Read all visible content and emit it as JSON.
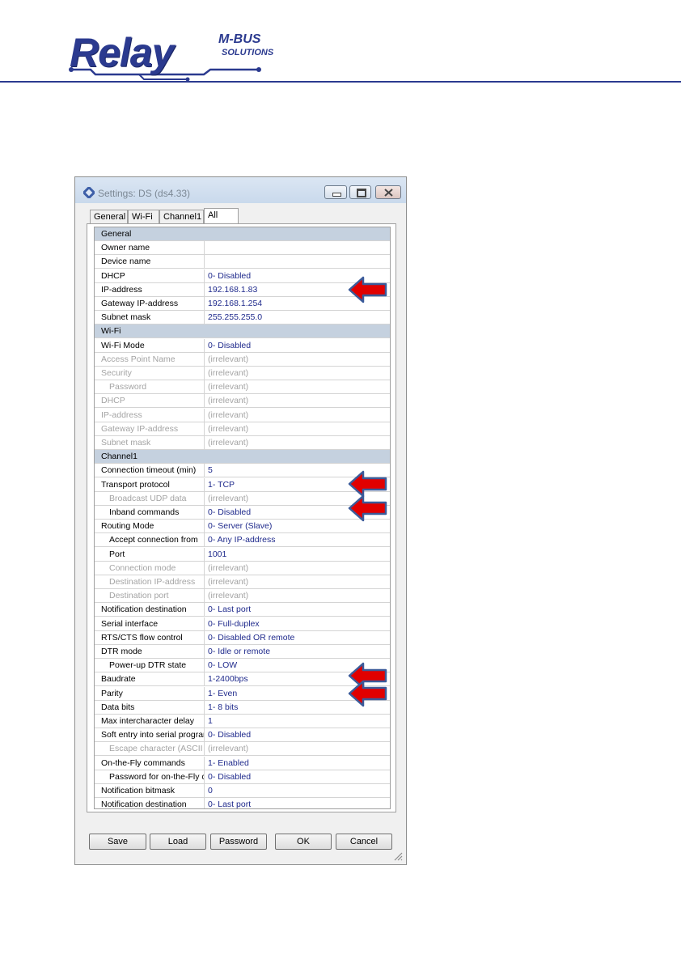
{
  "logo": {
    "main": "Relay",
    "mbus": "M-BUS",
    "solutions": "SOLUTIONS"
  },
  "window": {
    "title": "Settings: DS (ds4.33)",
    "tabs": [
      "General",
      "Wi-Fi",
      "Channel1",
      "All"
    ],
    "active_tab": "All",
    "rows": [
      {
        "type": "cat",
        "name": "General",
        "value": "",
        "indent": 0,
        "dim": false
      },
      {
        "type": "row",
        "name": "Owner name",
        "value": "",
        "indent": 0,
        "dim": false
      },
      {
        "type": "row",
        "name": "Device name",
        "value": "",
        "indent": 0,
        "dim": false
      },
      {
        "type": "row",
        "name": "DHCP",
        "value": "0- Disabled",
        "indent": 0,
        "dim": false
      },
      {
        "type": "row",
        "name": "IP-address",
        "value": "192.168.1.83",
        "indent": 0,
        "dim": false
      },
      {
        "type": "row",
        "name": "Gateway IP-address",
        "value": "192.168.1.254",
        "indent": 0,
        "dim": false
      },
      {
        "type": "row",
        "name": "Subnet mask",
        "value": "255.255.255.0",
        "indent": 0,
        "dim": false
      },
      {
        "type": "cat",
        "name": "Wi-Fi",
        "value": "",
        "indent": 0,
        "dim": false
      },
      {
        "type": "row",
        "name": "Wi-Fi Mode",
        "value": "0- Disabled",
        "indent": 0,
        "dim": false
      },
      {
        "type": "row",
        "name": "Access Point Name",
        "value": "(irrelevant)",
        "indent": 0,
        "dim": true
      },
      {
        "type": "row",
        "name": "Security",
        "value": "(irrelevant)",
        "indent": 0,
        "dim": true
      },
      {
        "type": "row",
        "name": "Password",
        "value": "(irrelevant)",
        "indent": 1,
        "dim": true
      },
      {
        "type": "row",
        "name": "DHCP",
        "value": "(irrelevant)",
        "indent": 0,
        "dim": true
      },
      {
        "type": "row",
        "name": "IP-address",
        "value": "(irrelevant)",
        "indent": 0,
        "dim": true
      },
      {
        "type": "row",
        "name": "Gateway IP-address",
        "value": "(irrelevant)",
        "indent": 0,
        "dim": true
      },
      {
        "type": "row",
        "name": "Subnet mask",
        "value": "(irrelevant)",
        "indent": 0,
        "dim": true
      },
      {
        "type": "cat",
        "name": "Channel1",
        "value": "",
        "indent": 0,
        "dim": false
      },
      {
        "type": "row",
        "name": "Connection timeout (min)",
        "value": "5",
        "indent": 0,
        "dim": false
      },
      {
        "type": "row",
        "name": "Transport protocol",
        "value": "1- TCP",
        "indent": 0,
        "dim": false
      },
      {
        "type": "row",
        "name": "Broadcast UDP data",
        "value": "(irrelevant)",
        "indent": 1,
        "dim": true
      },
      {
        "type": "row",
        "name": "Inband commands",
        "value": "0- Disabled",
        "indent": 1,
        "dim": false
      },
      {
        "type": "row",
        "name": "Routing Mode",
        "value": "0- Server (Slave)",
        "indent": 0,
        "dim": false
      },
      {
        "type": "row",
        "name": "Accept connection from",
        "value": "0- Any IP-address",
        "indent": 1,
        "dim": false
      },
      {
        "type": "row",
        "name": "Port",
        "value": "1001",
        "indent": 1,
        "dim": false
      },
      {
        "type": "row",
        "name": "Connection mode",
        "value": "(irrelevant)",
        "indent": 1,
        "dim": true
      },
      {
        "type": "row",
        "name": "Destination IP-address",
        "value": "(irrelevant)",
        "indent": 1,
        "dim": true
      },
      {
        "type": "row",
        "name": "Destination port",
        "value": "(irrelevant)",
        "indent": 1,
        "dim": true
      },
      {
        "type": "row",
        "name": "Notification destination",
        "value": "0- Last port",
        "indent": 0,
        "dim": false
      },
      {
        "type": "row",
        "name": "Serial interface",
        "value": "0- Full-duplex",
        "indent": 0,
        "dim": false
      },
      {
        "type": "row",
        "name": "RTS/CTS flow control",
        "value": "0- Disabled OR remote",
        "indent": 0,
        "dim": false
      },
      {
        "type": "row",
        "name": "DTR mode",
        "value": "0- Idle or remote",
        "indent": 0,
        "dim": false
      },
      {
        "type": "row",
        "name": "Power-up DTR state",
        "value": "0- LOW",
        "indent": 1,
        "dim": false
      },
      {
        "type": "row",
        "name": "Baudrate",
        "value": "1-2400bps",
        "indent": 0,
        "dim": false
      },
      {
        "type": "row",
        "name": "Parity",
        "value": "1- Even",
        "indent": 0,
        "dim": false
      },
      {
        "type": "row",
        "name": "Data bits",
        "value": "1- 8 bits",
        "indent": 0,
        "dim": false
      },
      {
        "type": "row",
        "name": "Max intercharacter delay",
        "value": "1",
        "indent": 0,
        "dim": false
      },
      {
        "type": "row",
        "name": "Soft entry into serial programm",
        "value": "0- Disabled",
        "indent": 0,
        "dim": false
      },
      {
        "type": "row",
        "name": "Escape character (ASCII co",
        "value": "(irrelevant)",
        "indent": 1,
        "dim": true
      },
      {
        "type": "row",
        "name": "On-the-Fly commands",
        "value": "1- Enabled",
        "indent": 0,
        "dim": false
      },
      {
        "type": "row",
        "name": "Password for on-the-Fly com",
        "value": "0- Disabled",
        "indent": 1,
        "dim": false
      },
      {
        "type": "row",
        "name": "Notification bitmask",
        "value": "0",
        "indent": 0,
        "dim": false
      },
      {
        "type": "row",
        "name": "Notification destination",
        "value": "0- Last port",
        "indent": 0,
        "dim": false
      }
    ],
    "buttons": {
      "save": "Save",
      "load": "Load",
      "password": "Password",
      "ok": "OK",
      "cancel": "Cancel"
    }
  },
  "colors": {
    "brand": "#2b3a8f",
    "value_text": "#1f2a8c",
    "category_bg": "#c5d1df",
    "arrow_fill": "#e10000",
    "arrow_stroke": "#3b5b9a"
  },
  "annotations": [
    "arrow-icon",
    "arrow-icon",
    "arrow-icon",
    "arrow-icon",
    "arrow-icon"
  ]
}
